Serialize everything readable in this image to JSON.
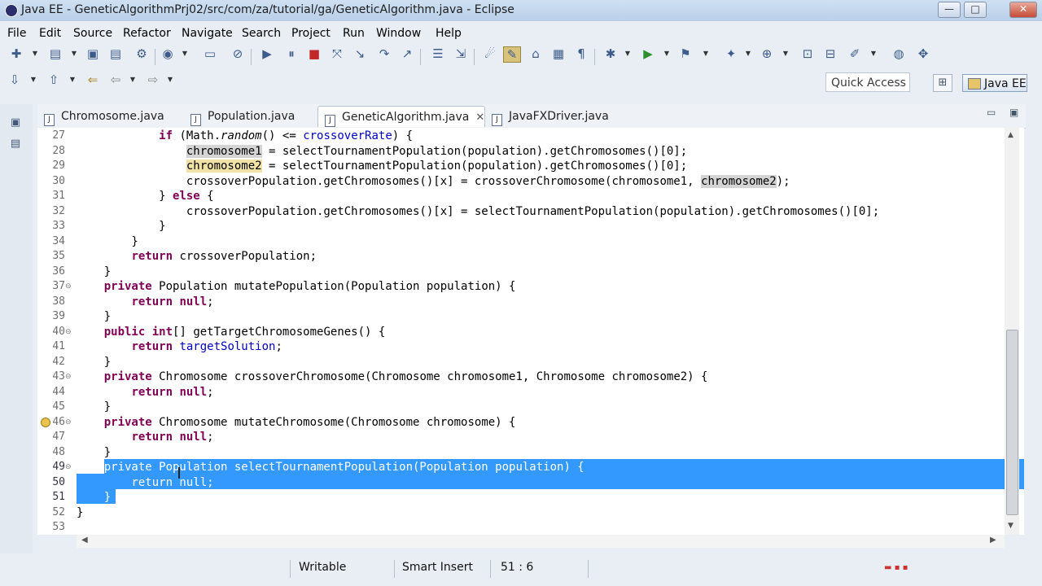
{
  "window": {
    "title": "Java EE - GeneticAlgorithmPrj02/src/com/za/tutorial/ga/GeneticAlgorithm.java - Eclipse",
    "buttons": {
      "minimize": "—",
      "maximize": "□",
      "close": "✕"
    }
  },
  "menu": [
    "File",
    "Edit",
    "Source",
    "Refactor",
    "Navigate",
    "Search",
    "Project",
    "Run",
    "Window",
    "Help"
  ],
  "quick_access": {
    "placeholder": "Quick Access"
  },
  "perspective": {
    "label": "Java EE"
  },
  "tabs": [
    {
      "label": "Chromosome.java",
      "active": false
    },
    {
      "label": "Population.java",
      "active": false
    },
    {
      "label": "GeneticAlgorithm.java",
      "active": true
    },
    {
      "label": "JavaFXDriver.java",
      "active": false
    }
  ],
  "tab_close": "✕",
  "view_controls": {
    "minimize": "▭",
    "maximize": "▣"
  },
  "editor": {
    "lines": [
      {
        "n": "27",
        "fold": ""
      },
      {
        "n": "28",
        "fold": ""
      },
      {
        "n": "29",
        "fold": ""
      },
      {
        "n": "30",
        "fold": ""
      },
      {
        "n": "31",
        "fold": ""
      },
      {
        "n": "32",
        "fold": ""
      },
      {
        "n": "33",
        "fold": ""
      },
      {
        "n": "34",
        "fold": ""
      },
      {
        "n": "35",
        "fold": ""
      },
      {
        "n": "36",
        "fold": ""
      },
      {
        "n": "37",
        "fold": "⊖"
      },
      {
        "n": "38",
        "fold": ""
      },
      {
        "n": "39",
        "fold": ""
      },
      {
        "n": "40",
        "fold": "⊖"
      },
      {
        "n": "41",
        "fold": ""
      },
      {
        "n": "42",
        "fold": ""
      },
      {
        "n": "43",
        "fold": "⊖"
      },
      {
        "n": "44",
        "fold": ""
      },
      {
        "n": "45",
        "fold": ""
      },
      {
        "n": "46",
        "fold": "⊖"
      },
      {
        "n": "47",
        "fold": ""
      },
      {
        "n": "48",
        "fold": ""
      },
      {
        "n": "49",
        "fold": "⊖"
      },
      {
        "n": "50",
        "fold": ""
      },
      {
        "n": "51",
        "fold": ""
      },
      {
        "n": "52",
        "fold": ""
      },
      {
        "n": "53",
        "fold": ""
      }
    ],
    "code": {
      "l27": [
        "            ",
        "if",
        " (Math.",
        "random",
        "() <= ",
        "crossoverRate",
        ") {"
      ],
      "l28": [
        "                ",
        "chromosome1",
        " = selectTournamentPopulation(population).getChromosomes()[0];"
      ],
      "l29": [
        "                ",
        "chromosome2",
        " = selectTournamentPopulation(population).getChromosomes()[0];"
      ],
      "l30": [
        "                crossoverPopulation.getChromosomes()[x] = crossoverChromosome(chromosome1, ",
        "chromosome2",
        ");"
      ],
      "l31": [
        "            } ",
        "else",
        " {"
      ],
      "l32": [
        "                crossoverPopulation.getChromosomes()[x] = selectTournamentPopulation(population).getChromosomes()[0];"
      ],
      "l33": [
        "            }"
      ],
      "l34": [
        "        }"
      ],
      "l35": [
        "        ",
        "return",
        " crossoverPopulation;"
      ],
      "l36": [
        "    }"
      ],
      "l37": [
        "    ",
        "private",
        " Population mutatePopulation(Population population) {"
      ],
      "l38": [
        "        ",
        "return",
        " ",
        "null",
        ";"
      ],
      "l39": [
        "    }"
      ],
      "l40": [
        "    ",
        "public",
        " ",
        "int",
        "[] getTargetChromosomeGenes() {"
      ],
      "l41": [
        "        ",
        "return",
        " ",
        "targetSolution",
        ";"
      ],
      "l42": [
        "    }"
      ],
      "l43": [
        "    ",
        "private",
        " Chromosome crossoverChromosome(Chromosome chromosome1, Chromosome chromosome2) {"
      ],
      "l44": [
        "        ",
        "return",
        " ",
        "null",
        ";"
      ],
      "l45": [
        "    }"
      ],
      "l46": [
        "    ",
        "private",
        " Chromosome mutateChromosome(Chromosome chromosome) {"
      ],
      "l47": [
        "        ",
        "return",
        " ",
        "null",
        ";"
      ],
      "l48": [
        "    }"
      ],
      "l49": [
        "    private Population selectTournamentPopulation(Population population) {"
      ],
      "l50": [
        "        return null;"
      ],
      "l51": [
        "    }"
      ],
      "l52": [
        "}"
      ],
      "l53": [
        ""
      ]
    }
  },
  "status": {
    "writable": "Writable",
    "insert_mode": "Smart Insert",
    "position": "51 : 6"
  }
}
